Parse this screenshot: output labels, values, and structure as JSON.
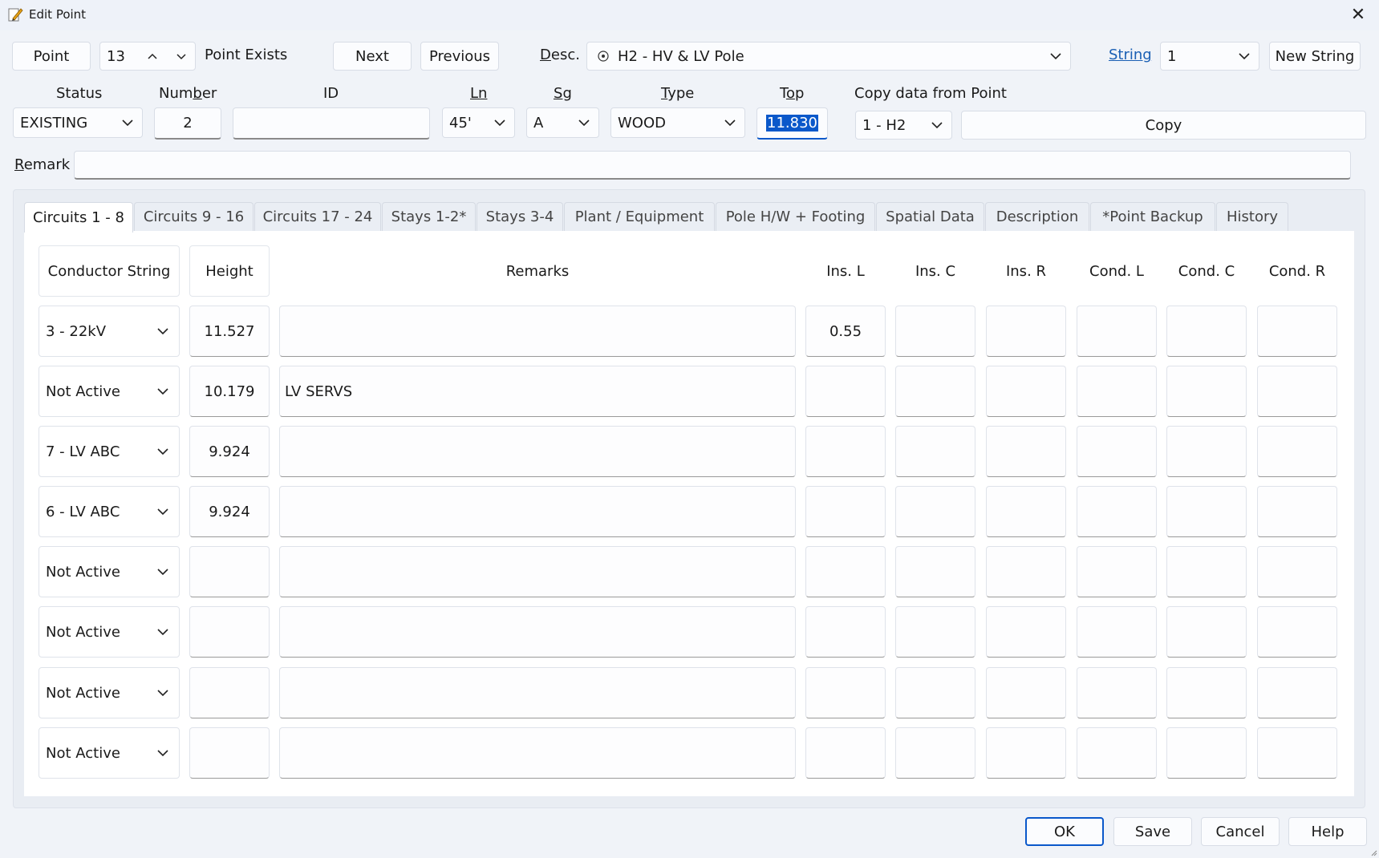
{
  "window": {
    "title": "Edit Point"
  },
  "toolbar": {
    "point_label": "Point",
    "point_number": "13",
    "point_status": "Point Exists",
    "next_label": "Next",
    "previous_label": "Previous",
    "desc_label": "Desc.",
    "desc_value": "H2 - HV & LV Pole",
    "string_label": "String",
    "string_value": "1",
    "new_string_label": "New String"
  },
  "fields": {
    "status_label": "Status",
    "status_value": "EXISTING",
    "number_label": "Number",
    "number_value": "2",
    "id_label": "ID",
    "id_value": "",
    "ln_label": "Ln",
    "ln_value": "45'",
    "sg_label": "Sg",
    "sg_value": "A",
    "type_label": "Type",
    "type_value": "WOOD",
    "top_label": "Top",
    "top_value": "11.830",
    "copy_from_label": "Copy data from Point",
    "copy_from_value": "1 - H2",
    "copy_label": "Copy",
    "remark_label": "Remark",
    "remark_value": ""
  },
  "tabs": [
    {
      "label": "Circuits 1 - 8"
    },
    {
      "label": "Circuits 9 - 16"
    },
    {
      "label": "Circuits 17 - 24"
    },
    {
      "label": "Stays 1-2*"
    },
    {
      "label": "Stays 3-4"
    },
    {
      "label": "Plant / Equipment"
    },
    {
      "label": "Pole H/W + Footing"
    },
    {
      "label": "Spatial Data"
    },
    {
      "label": "Description"
    },
    {
      "label": "*Point Backup"
    },
    {
      "label": "History"
    }
  ],
  "table": {
    "headers": {
      "conductor": "Conductor String",
      "height": "Height",
      "remarks": "Remarks",
      "ins_l": "Ins. L",
      "ins_c": "Ins. C",
      "ins_r": "Ins. R",
      "cond_l": "Cond. L",
      "cond_c": "Cond. C",
      "cond_r": "Cond. R"
    },
    "rows": [
      {
        "string": "3 - 22kV",
        "height": "11.527",
        "remarks": "",
        "ins_l": "0.55",
        "ins_c": "",
        "ins_r": "",
        "cond_l": "",
        "cond_c": "",
        "cond_r": ""
      },
      {
        "string": "Not Active",
        "height": "10.179",
        "remarks": "LV SERVS",
        "ins_l": "",
        "ins_c": "",
        "ins_r": "",
        "cond_l": "",
        "cond_c": "",
        "cond_r": ""
      },
      {
        "string": "7 - LV ABC",
        "height": "9.924",
        "remarks": "",
        "ins_l": "",
        "ins_c": "",
        "ins_r": "",
        "cond_l": "",
        "cond_c": "",
        "cond_r": ""
      },
      {
        "string": "6 - LV ABC",
        "height": "9.924",
        "remarks": "",
        "ins_l": "",
        "ins_c": "",
        "ins_r": "",
        "cond_l": "",
        "cond_c": "",
        "cond_r": ""
      },
      {
        "string": "Not Active",
        "height": "",
        "remarks": "",
        "ins_l": "",
        "ins_c": "",
        "ins_r": "",
        "cond_l": "",
        "cond_c": "",
        "cond_r": ""
      },
      {
        "string": "Not Active",
        "height": "",
        "remarks": "",
        "ins_l": "",
        "ins_c": "",
        "ins_r": "",
        "cond_l": "",
        "cond_c": "",
        "cond_r": ""
      },
      {
        "string": "Not Active",
        "height": "",
        "remarks": "",
        "ins_l": "",
        "ins_c": "",
        "ins_r": "",
        "cond_l": "",
        "cond_c": "",
        "cond_r": ""
      },
      {
        "string": "Not Active",
        "height": "",
        "remarks": "",
        "ins_l": "",
        "ins_c": "",
        "ins_r": "",
        "cond_l": "",
        "cond_c": "",
        "cond_r": ""
      }
    ]
  },
  "footer": {
    "ok_label": "OK",
    "save_label": "Save",
    "cancel_label": "Cancel",
    "help_label": "Help"
  },
  "colors": {
    "accent": "#0a58ca",
    "link": "#1a5fb4"
  }
}
